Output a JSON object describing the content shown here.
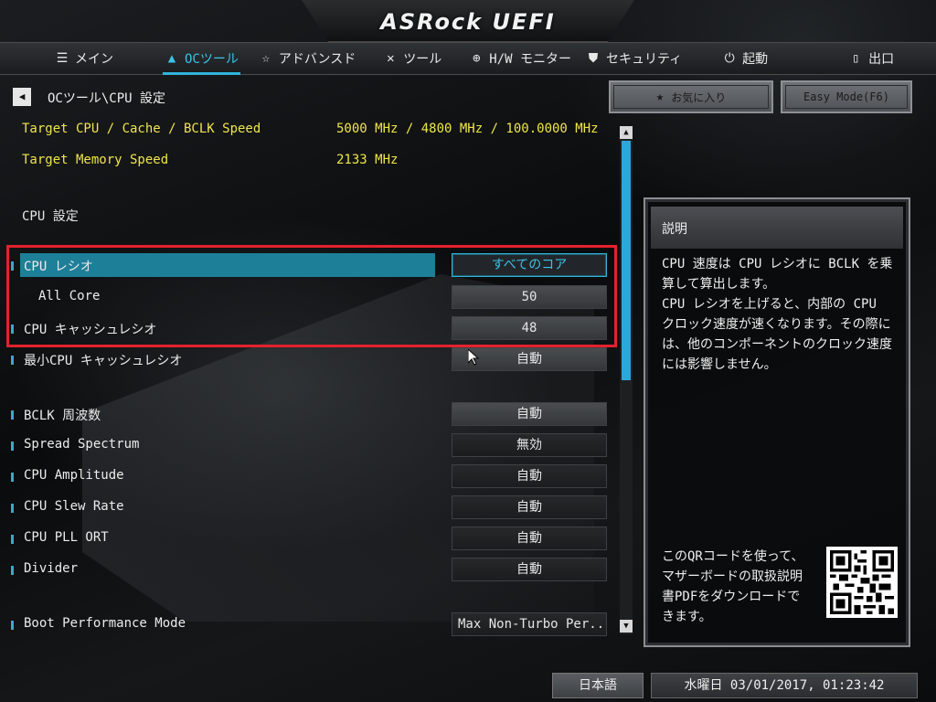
{
  "brand": "ASRock UEFI",
  "nav": {
    "tabs": [
      {
        "label": "メイン",
        "icon": "list-icon"
      },
      {
        "label": "OCツール",
        "icon": "rocket-icon",
        "active": true
      },
      {
        "label": "アドバンスド",
        "icon": "star-icon"
      },
      {
        "label": "ツール",
        "icon": "tools-icon"
      },
      {
        "label": "H/W モニター",
        "icon": "crosshair-icon"
      },
      {
        "label": "セキュリティ",
        "icon": "shield-icon"
      },
      {
        "label": "起動",
        "icon": "power-icon"
      },
      {
        "label": "出口",
        "icon": "exit-icon"
      }
    ]
  },
  "breadcrumb": "OCツール\\CPU 設定",
  "toolbar": {
    "favorites_label": "お気に入り",
    "easy_mode_label": "Easy Mode(F6)"
  },
  "info": {
    "target_cpu_label": "Target CPU / Cache / BCLK Speed",
    "target_cpu_value": "5000 MHz / 4800 MHz / 100.0000 MHz",
    "target_mem_label": "Target Memory Speed",
    "target_mem_value": "2133 MHz"
  },
  "section_title": "CPU 設定",
  "settings": [
    {
      "label": "CPU レシオ",
      "value": "すべてのコア"
    },
    {
      "label": "All Core",
      "value": "50"
    },
    {
      "label": "CPU キャッシュレシオ",
      "value": "48"
    },
    {
      "label": "最小CPU キャッシュレシオ",
      "value": "自動"
    },
    {
      "label": "BCLK 周波数",
      "value": "自動"
    },
    {
      "label": "Spread Spectrum",
      "value": "無効"
    },
    {
      "label": "CPU Amplitude",
      "value": "自動"
    },
    {
      "label": "CPU Slew Rate",
      "value": "自動"
    },
    {
      "label": "CPU PLL ORT",
      "value": "自動"
    },
    {
      "label": "Divider",
      "value": "自動"
    },
    {
      "label": "Boot Performance Mode",
      "value": "Max Non-Turbo Per..."
    }
  ],
  "description": {
    "title": "説明",
    "body": "CPU 速度は CPU レシオに BCLK を乗算して算出します。\nCPU レシオを上げると、内部の CPU クロック速度が速くなります。その際には、他のコンポーネントのクロック速度には影響しません。",
    "qr_text": "このQRコードを使って、マザーボードの取扱説明書PDFをダウンロードできます。"
  },
  "footer": {
    "language": "日本語",
    "datetime": "水曜日 03/01/2017, 01:23:42"
  },
  "colors": {
    "accent": "#2fb4da",
    "info_text": "#f0e64a",
    "selection": "#1e7f98",
    "highlight_box": "#e4212d"
  }
}
